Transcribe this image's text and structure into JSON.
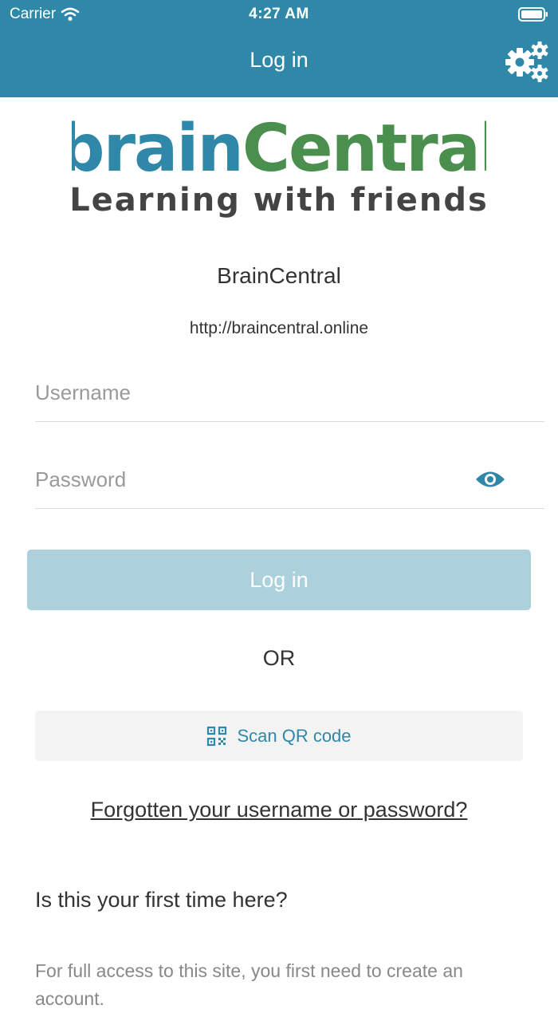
{
  "status_bar": {
    "carrier": "Carrier",
    "time": "4:27 AM"
  },
  "header": {
    "title": "Log in",
    "settings_icon": "gears-icon",
    "background_color": "#2f88a8"
  },
  "logo": {
    "brand_part1": "brain",
    "brand_part2": "Central",
    "tagline": "Learning with friends",
    "color_blue": "#2f88a8",
    "color_green": "#4a8f4e"
  },
  "site": {
    "name": "BrainCentral",
    "url": "http://braincentral.online"
  },
  "form": {
    "username_placeholder": "Username",
    "password_placeholder": "Password",
    "login_label": "Log in",
    "or_label": "OR",
    "scan_qr_label": "Scan QR code",
    "forgot_label": "Forgotten your username or password?"
  },
  "first_time": {
    "heading": "Is this your first time here?",
    "body": "For full access to this site, you first need to create an account."
  }
}
